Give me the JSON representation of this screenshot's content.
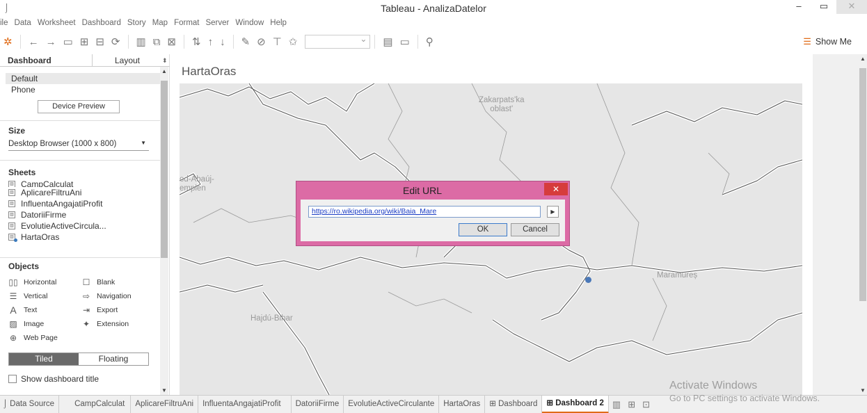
{
  "window": {
    "title": "Tableau - AnalizaDatelor"
  },
  "menu": [
    "ile",
    "Data",
    "Worksheet",
    "Dashboard",
    "Story",
    "Map",
    "Format",
    "Server",
    "Window",
    "Help"
  ],
  "toolbar": {
    "show_me_label": "Show Me"
  },
  "left_panel": {
    "tabs": {
      "dashboard": "Dashboard",
      "layout": "Layout"
    },
    "devices": [
      "Default",
      "Phone"
    ],
    "device_preview_label": "Device Preview",
    "size_header": "Size",
    "size_value": "Desktop Browser (1000 x 800)",
    "sheets_header": "Sheets",
    "sheets": [
      "CampCalculat",
      "AplicareFiltruAni",
      "InfluentaAngajatiProfit",
      "DatoriiFirme",
      "EvolutieActiveCircula...",
      "HartaOras"
    ],
    "objects_header": "Objects",
    "objects": [
      {
        "left": "Horizontal",
        "right": "Blank"
      },
      {
        "left": "Vertical",
        "right": "Navigation"
      },
      {
        "left": "Text",
        "right": "Export"
      },
      {
        "left": "Image",
        "right": "Extension"
      },
      {
        "left": "Web Page",
        "right": ""
      }
    ],
    "layout_mode": {
      "tiled": "Tiled",
      "floating": "Floating"
    },
    "show_title_label": "Show dashboard title"
  },
  "dashboard": {
    "title": "HartaOras",
    "map_labels": {
      "zakarpats": "Zakarpats'ka",
      "oblast": "oblast'",
      "abauj1": "od-Abaúj-",
      "abauj2": "emplén",
      "maramures": "Maramureș",
      "hajdu": "Hajdú-Bihar"
    }
  },
  "dialog": {
    "title": "Edit URL",
    "url": "https://ro.wikipedia.org/wiki/Baia_Mare",
    "ok_label": "OK",
    "cancel_label": "Cancel"
  },
  "bottom_tabs": [
    "Data Source",
    "CampCalculat",
    "AplicareFiltruAni",
    "InfluentaAngajatiProfit",
    "DatoriiFirme",
    "EvolutieActiveCirculante",
    "HartaOras",
    "Dashboard",
    "Dashboard 2"
  ],
  "watermark": {
    "line1": "Activate Windows",
    "line2": "Go to PC settings to activate Windows."
  }
}
